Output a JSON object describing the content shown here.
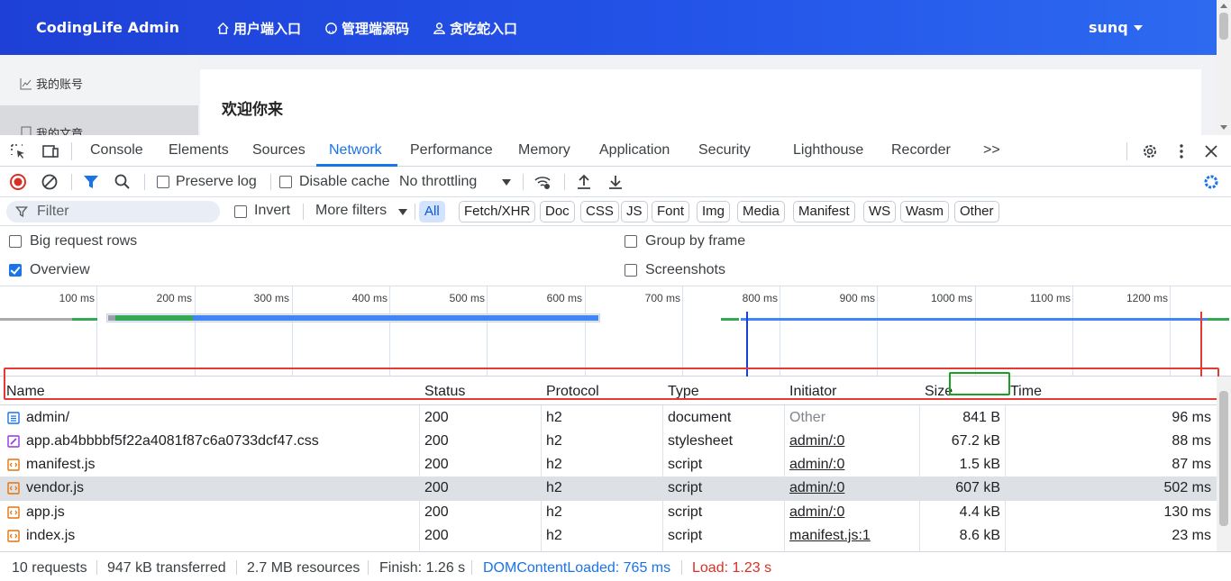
{
  "app": {
    "brand": "CodingLife Admin",
    "nav": [
      {
        "label": "用户端入口",
        "icon": "home-icon"
      },
      {
        "label": "管理端源码",
        "icon": "github-icon"
      },
      {
        "label": "贪吃蛇入口",
        "icon": "user-icon"
      }
    ],
    "user": "sunq",
    "sidebar": [
      "我的账号",
      "我的文章"
    ],
    "welcome": "欢迎你来"
  },
  "devtools": {
    "tabs": [
      "Console",
      "Elements",
      "Sources",
      "Network",
      "Performance",
      "Memory",
      "Application",
      "Security",
      "Lighthouse",
      "Recorder"
    ],
    "active_tab": "Network",
    "more_tabs": ">>",
    "toolbar": {
      "preserve_log": "Preserve log",
      "disable_cache": "Disable cache",
      "throttling": "No throttling"
    },
    "filter": {
      "placeholder": "Filter",
      "invert": "Invert",
      "more_filters": "More filters",
      "chips": [
        "All",
        "Fetch/XHR",
        "Doc",
        "CSS",
        "JS",
        "Font",
        "Img",
        "Media",
        "Manifest",
        "WS",
        "Wasm",
        "Other"
      ],
      "active_chip": "All"
    },
    "options": {
      "big_request_rows": "Big request rows",
      "overview": "Overview",
      "group_by_frame": "Group by frame",
      "screenshots": "Screenshots",
      "overview_checked": true
    },
    "overview_ticks": [
      "100 ms",
      "200 ms",
      "300 ms",
      "400 ms",
      "500 ms",
      "600 ms",
      "700 ms",
      "800 ms",
      "900 ms",
      "1000 ms",
      "1100 ms",
      "1200 ms"
    ],
    "columns": [
      "Name",
      "Status",
      "Protocol",
      "Type",
      "Initiator",
      "Size",
      "Time"
    ],
    "rows": [
      {
        "name": "admin/",
        "status": "200",
        "protocol": "h2",
        "type": "document",
        "initiator": "Other",
        "size": "841 B",
        "time": "96 ms",
        "icon": "document-icon"
      },
      {
        "name": "app.ab4bbbbf5f22a4081f87c6a0733dcf47.css",
        "status": "200",
        "protocol": "h2",
        "type": "stylesheet",
        "initiator": "admin/:0",
        "size": "67.2 kB",
        "time": "88 ms",
        "icon": "stylesheet-icon"
      },
      {
        "name": "manifest.js",
        "status": "200",
        "protocol": "h2",
        "type": "script",
        "initiator": "admin/:0",
        "size": "1.5 kB",
        "time": "87 ms",
        "icon": "script-icon"
      },
      {
        "name": "vendor.js",
        "status": "200",
        "protocol": "h2",
        "type": "script",
        "initiator": "admin/:0",
        "size": "607 kB",
        "time": "502 ms",
        "icon": "script-icon"
      },
      {
        "name": "app.js",
        "status": "200",
        "protocol": "h2",
        "type": "script",
        "initiator": "admin/:0",
        "size": "4.4 kB",
        "time": "130 ms",
        "icon": "script-icon"
      },
      {
        "name": "index.js",
        "status": "200",
        "protocol": "h2",
        "type": "script",
        "initiator": "manifest.js:1",
        "size": "8.6 kB",
        "time": "23 ms",
        "icon": "script-icon"
      }
    ],
    "status": {
      "requests": "10 requests",
      "transferred": "947 kB transferred",
      "resources": "2.7 MB resources",
      "finish": "Finish: 1.26 s",
      "dom_loaded": "DOMContentLoaded: 765 ms",
      "load": "Load: 1.23 s"
    },
    "colors": {
      "accent": "#1a73e8",
      "highlight_box": "#e53935",
      "size_box": "#1aa121"
    }
  }
}
